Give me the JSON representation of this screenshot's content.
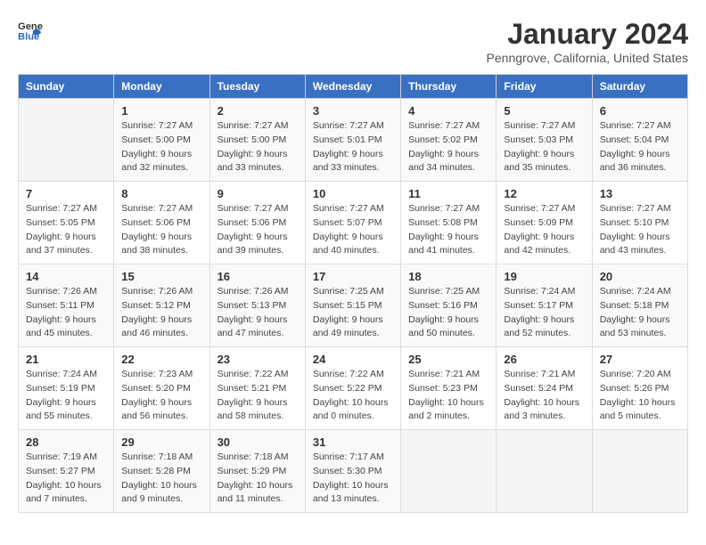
{
  "logo": {
    "general": "General",
    "blue": "Blue"
  },
  "header": {
    "title": "January 2024",
    "subtitle": "Penngrove, California, United States"
  },
  "calendar": {
    "weekdays": [
      "Sunday",
      "Monday",
      "Tuesday",
      "Wednesday",
      "Thursday",
      "Friday",
      "Saturday"
    ],
    "weeks": [
      [
        {
          "day": "",
          "info": ""
        },
        {
          "day": "1",
          "info": "Sunrise: 7:27 AM\nSunset: 5:00 PM\nDaylight: 9 hours\nand 32 minutes."
        },
        {
          "day": "2",
          "info": "Sunrise: 7:27 AM\nSunset: 5:00 PM\nDaylight: 9 hours\nand 33 minutes."
        },
        {
          "day": "3",
          "info": "Sunrise: 7:27 AM\nSunset: 5:01 PM\nDaylight: 9 hours\nand 33 minutes."
        },
        {
          "day": "4",
          "info": "Sunrise: 7:27 AM\nSunset: 5:02 PM\nDaylight: 9 hours\nand 34 minutes."
        },
        {
          "day": "5",
          "info": "Sunrise: 7:27 AM\nSunset: 5:03 PM\nDaylight: 9 hours\nand 35 minutes."
        },
        {
          "day": "6",
          "info": "Sunrise: 7:27 AM\nSunset: 5:04 PM\nDaylight: 9 hours\nand 36 minutes."
        }
      ],
      [
        {
          "day": "7",
          "info": "Sunrise: 7:27 AM\nSunset: 5:05 PM\nDaylight: 9 hours\nand 37 minutes."
        },
        {
          "day": "8",
          "info": "Sunrise: 7:27 AM\nSunset: 5:06 PM\nDaylight: 9 hours\nand 38 minutes."
        },
        {
          "day": "9",
          "info": "Sunrise: 7:27 AM\nSunset: 5:06 PM\nDaylight: 9 hours\nand 39 minutes."
        },
        {
          "day": "10",
          "info": "Sunrise: 7:27 AM\nSunset: 5:07 PM\nDaylight: 9 hours\nand 40 minutes."
        },
        {
          "day": "11",
          "info": "Sunrise: 7:27 AM\nSunset: 5:08 PM\nDaylight: 9 hours\nand 41 minutes."
        },
        {
          "day": "12",
          "info": "Sunrise: 7:27 AM\nSunset: 5:09 PM\nDaylight: 9 hours\nand 42 minutes."
        },
        {
          "day": "13",
          "info": "Sunrise: 7:27 AM\nSunset: 5:10 PM\nDaylight: 9 hours\nand 43 minutes."
        }
      ],
      [
        {
          "day": "14",
          "info": "Sunrise: 7:26 AM\nSunset: 5:11 PM\nDaylight: 9 hours\nand 45 minutes."
        },
        {
          "day": "15",
          "info": "Sunrise: 7:26 AM\nSunset: 5:12 PM\nDaylight: 9 hours\nand 46 minutes."
        },
        {
          "day": "16",
          "info": "Sunrise: 7:26 AM\nSunset: 5:13 PM\nDaylight: 9 hours\nand 47 minutes."
        },
        {
          "day": "17",
          "info": "Sunrise: 7:25 AM\nSunset: 5:15 PM\nDaylight: 9 hours\nand 49 minutes."
        },
        {
          "day": "18",
          "info": "Sunrise: 7:25 AM\nSunset: 5:16 PM\nDaylight: 9 hours\nand 50 minutes."
        },
        {
          "day": "19",
          "info": "Sunrise: 7:24 AM\nSunset: 5:17 PM\nDaylight: 9 hours\nand 52 minutes."
        },
        {
          "day": "20",
          "info": "Sunrise: 7:24 AM\nSunset: 5:18 PM\nDaylight: 9 hours\nand 53 minutes."
        }
      ],
      [
        {
          "day": "21",
          "info": "Sunrise: 7:24 AM\nSunset: 5:19 PM\nDaylight: 9 hours\nand 55 minutes."
        },
        {
          "day": "22",
          "info": "Sunrise: 7:23 AM\nSunset: 5:20 PM\nDaylight: 9 hours\nand 56 minutes."
        },
        {
          "day": "23",
          "info": "Sunrise: 7:22 AM\nSunset: 5:21 PM\nDaylight: 9 hours\nand 58 minutes."
        },
        {
          "day": "24",
          "info": "Sunrise: 7:22 AM\nSunset: 5:22 PM\nDaylight: 10 hours\nand 0 minutes."
        },
        {
          "day": "25",
          "info": "Sunrise: 7:21 AM\nSunset: 5:23 PM\nDaylight: 10 hours\nand 2 minutes."
        },
        {
          "day": "26",
          "info": "Sunrise: 7:21 AM\nSunset: 5:24 PM\nDaylight: 10 hours\nand 3 minutes."
        },
        {
          "day": "27",
          "info": "Sunrise: 7:20 AM\nSunset: 5:26 PM\nDaylight: 10 hours\nand 5 minutes."
        }
      ],
      [
        {
          "day": "28",
          "info": "Sunrise: 7:19 AM\nSunset: 5:27 PM\nDaylight: 10 hours\nand 7 minutes."
        },
        {
          "day": "29",
          "info": "Sunrise: 7:18 AM\nSunset: 5:28 PM\nDaylight: 10 hours\nand 9 minutes."
        },
        {
          "day": "30",
          "info": "Sunrise: 7:18 AM\nSunset: 5:29 PM\nDaylight: 10 hours\nand 11 minutes."
        },
        {
          "day": "31",
          "info": "Sunrise: 7:17 AM\nSunset: 5:30 PM\nDaylight: 10 hours\nand 13 minutes."
        },
        {
          "day": "",
          "info": ""
        },
        {
          "day": "",
          "info": ""
        },
        {
          "day": "",
          "info": ""
        }
      ]
    ]
  }
}
